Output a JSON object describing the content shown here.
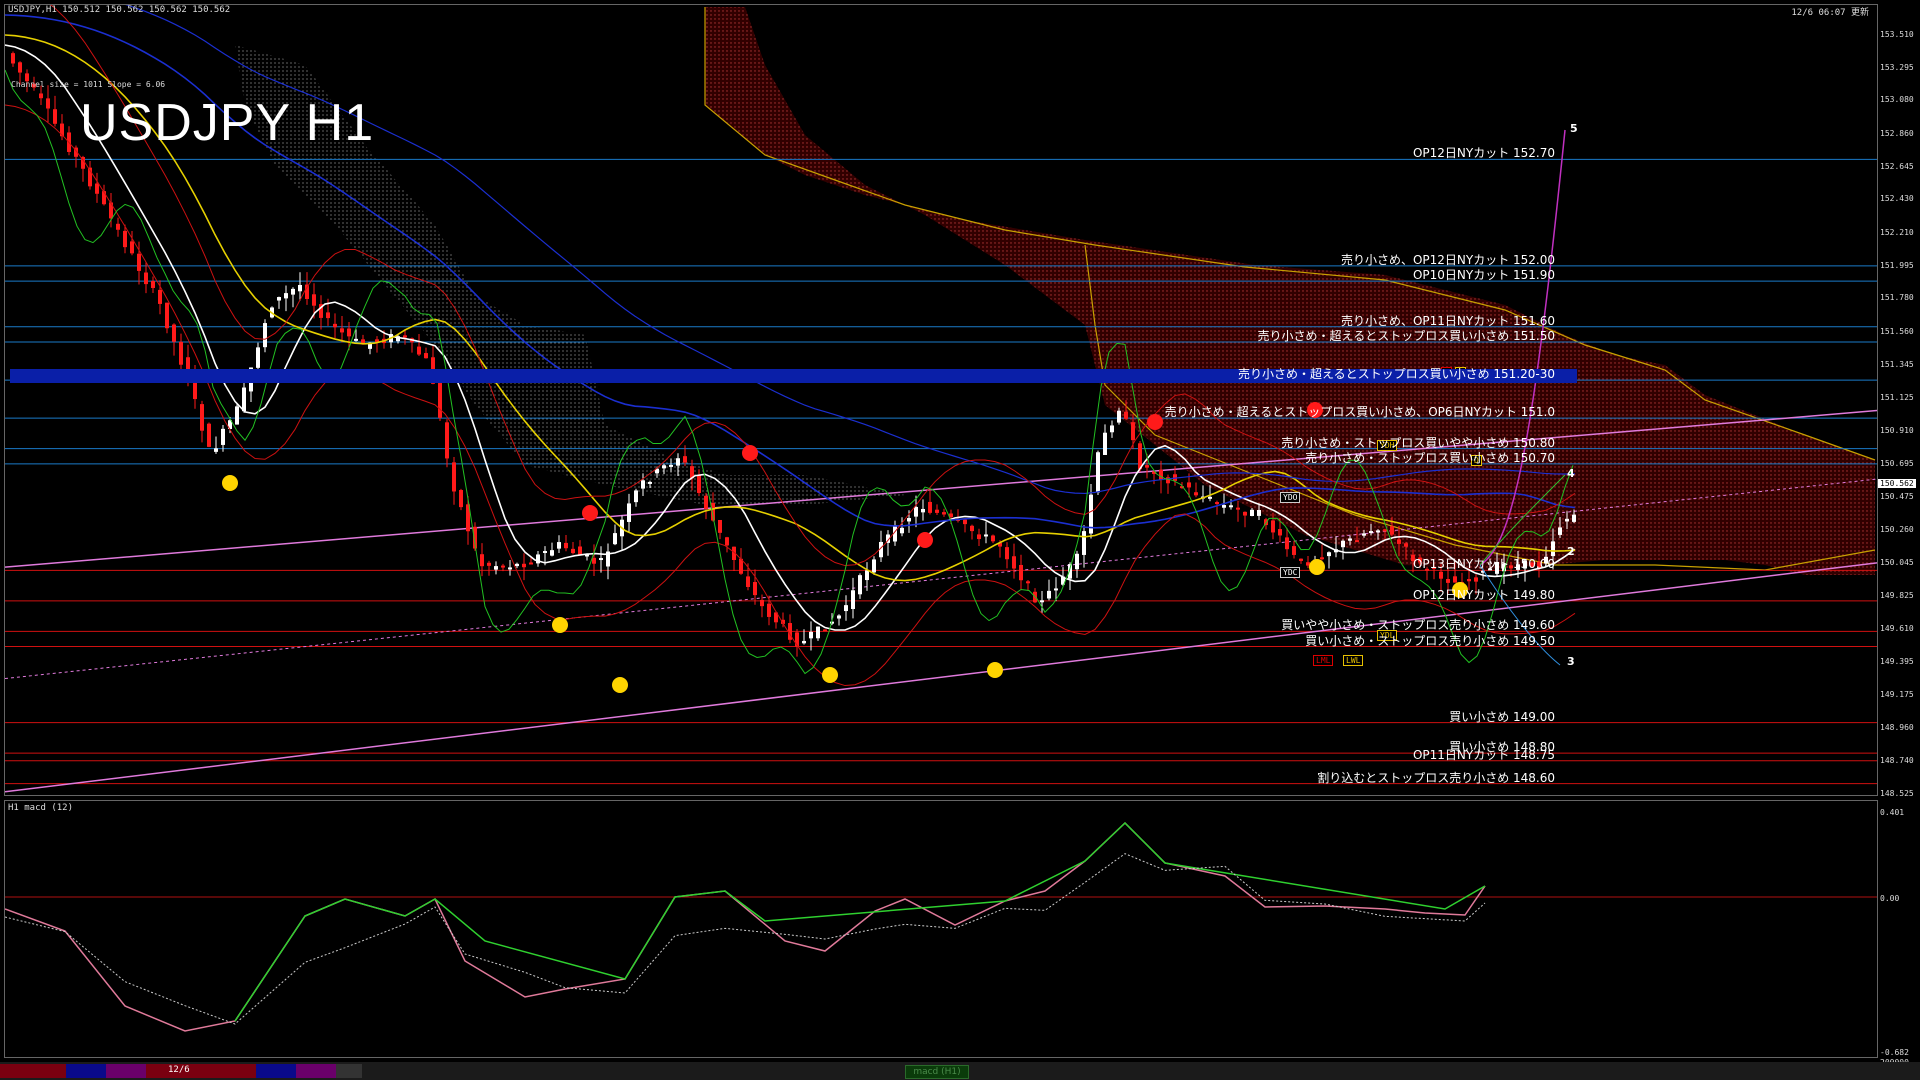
{
  "header": {
    "symbol_info": "USDJPY,H1  150.512 150.562 150.562 150.562",
    "update_time": "12/6 06:07 更新",
    "channel_info": "Channel size = 1011 Slope = 6.06",
    "title": "USDJPY H1"
  },
  "main_axis": {
    "ticks": [
      "153.510",
      "153.295",
      "153.080",
      "152.860",
      "152.645",
      "152.430",
      "152.210",
      "151.995",
      "151.780",
      "151.560",
      "151.345",
      "151.125",
      "150.910",
      "150.695",
      "150.475",
      "150.260",
      "150.045",
      "149.825",
      "149.610",
      "149.395",
      "149.175",
      "148.960",
      "148.740",
      "148.525"
    ],
    "current_price": "150.562"
  },
  "macd_axis": {
    "ticks": [
      "0.401",
      "0.00",
      "-0.682"
    ],
    "bottom": "200000"
  },
  "macd_pane": {
    "title": "H1  macd (12)"
  },
  "levels": [
    {
      "label": "OP12日NYカット 152.70",
      "price": 152.7,
      "color": "#1a7ac8"
    },
    {
      "label": "売り小さめ、OP12日NYカット 152.00",
      "price": 152.0,
      "color": "#1a7ac8"
    },
    {
      "label": "OP10日NYカット 151.90",
      "price": 151.9,
      "color": "#1a7ac8"
    },
    {
      "label": "売り小さめ、OP11日NYカット 151.60",
      "price": 151.6,
      "color": "#1a7ac8"
    },
    {
      "label": "売り小さめ・超えるとストップロス買い小さめ 151.50",
      "price": 151.5,
      "color": "#1a7ac8"
    },
    {
      "label": "売り小さめ・超えるとストップロス買い小さめ 151.20-30",
      "price": 151.25,
      "color": "#1a7ac8"
    },
    {
      "label": "売り小さめ・超えるとストップロス買い小さめ、OP6日NYカット 151.0",
      "price": 151.0,
      "color": "#1a7ac8"
    },
    {
      "label": "売り小さめ・ストップロス買いやや小さめ 150.80",
      "price": 150.8,
      "color": "#1a7ac8"
    },
    {
      "label": "売り小さめ・ストップロス買い小さめ 150.70",
      "price": 150.7,
      "color": "#1a7ac8"
    },
    {
      "label": "OP13日NYカット 150.00",
      "price": 150.0,
      "color": "#d01010"
    },
    {
      "label": "OP12日NYカット 149.80",
      "price": 149.8,
      "color": "#d01010"
    },
    {
      "label": "買いやや小さめ・ストップロス売り小さめ 149.60",
      "price": 149.6,
      "color": "#d01010"
    },
    {
      "label": "買い小さめ・ストップロス売り小さめ 149.50",
      "price": 149.5,
      "color": "#d01010"
    },
    {
      "label": "買い小さめ 149.00",
      "price": 149.0,
      "color": "#d01010"
    },
    {
      "label": "買い小さめ 148.80",
      "price": 148.8,
      "color": "#d01010"
    },
    {
      "label": "OP11日NYカット 148.75",
      "price": 148.75,
      "color": "#d01010"
    },
    {
      "label": "割り込むとストップロス売り小さめ 148.60",
      "price": 148.6,
      "color": "#d01010"
    }
  ],
  "waves": [
    "5",
    "4",
    "2",
    "3"
  ],
  "boxes": [
    "YDH",
    "YDO",
    "YDC",
    "YDL",
    "LML",
    "LWL",
    "M",
    "W",
    "D"
  ],
  "tabbar": {
    "date": "12/6",
    "macd_tab": "macd (H1)"
  },
  "colors": {
    "level_blue": "#1a7ac8",
    "level_red": "#d01010",
    "ma_yellow": "#e6d000",
    "ma_white": "#ffffff",
    "ma_blue": "#1b2fd0",
    "trend_pink": "#e07adc",
    "macd_green": "#2fd02f",
    "macd_pink": "#e07a9a"
  }
}
